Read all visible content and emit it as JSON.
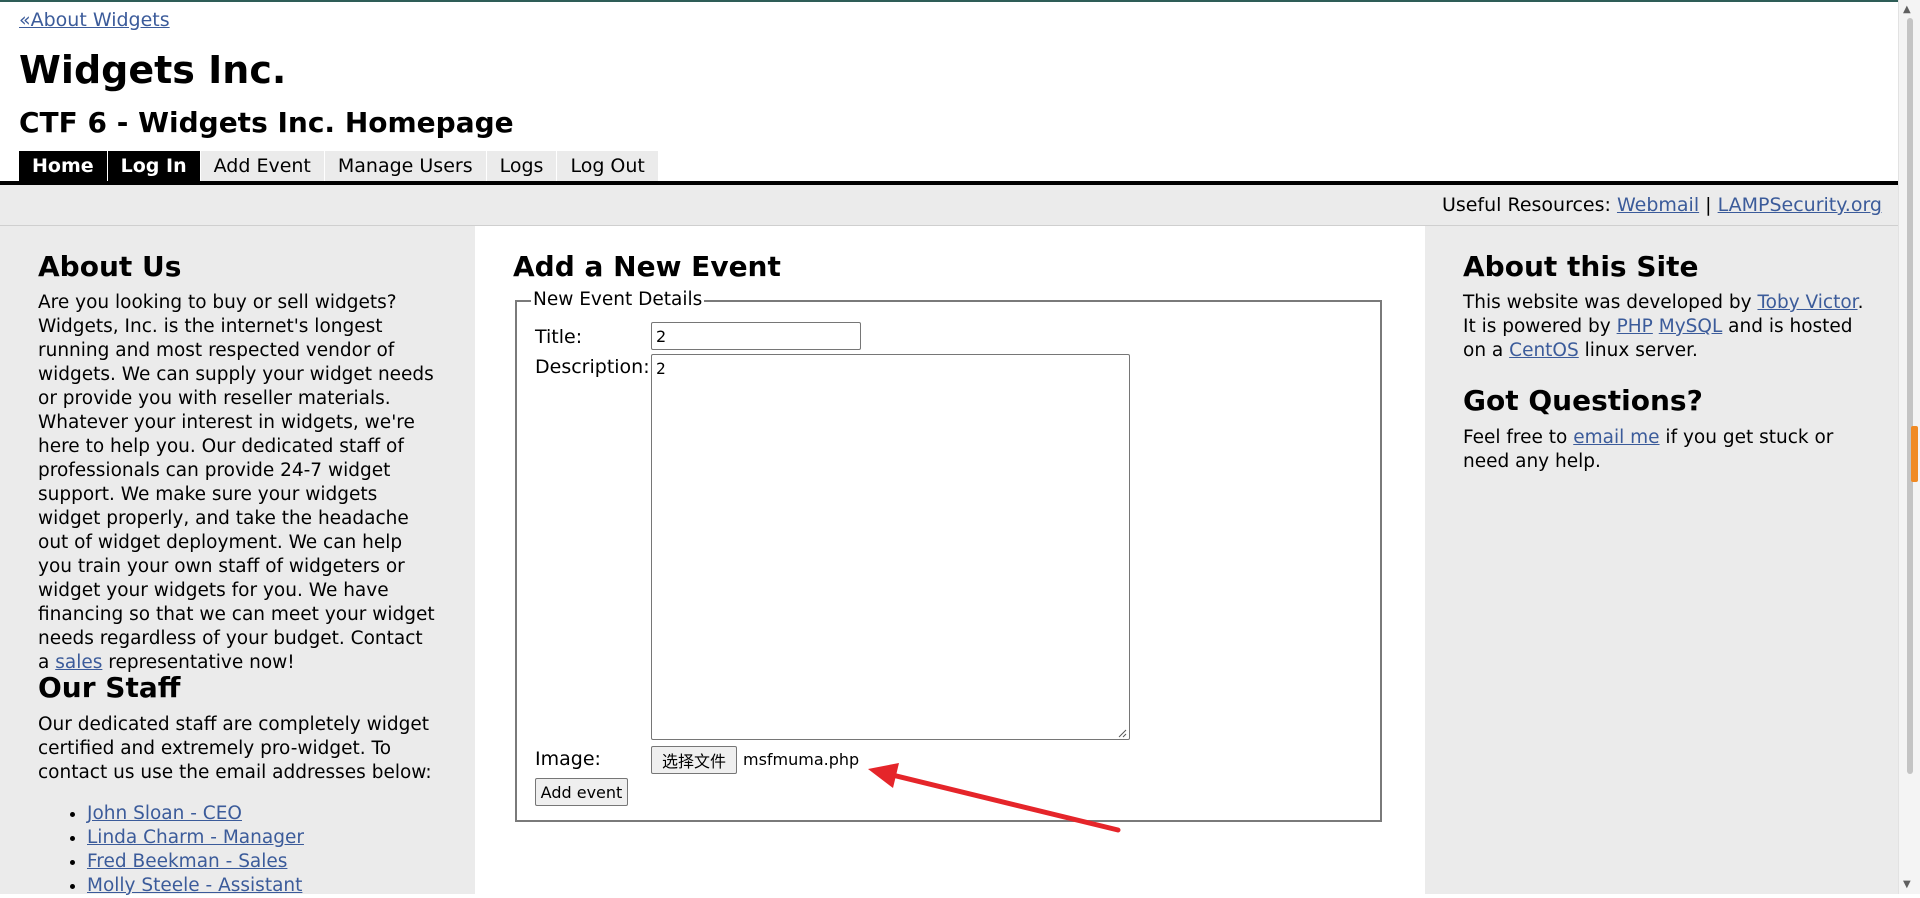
{
  "header": {
    "back_link": "«About Widgets",
    "site_title": "Widgets Inc.",
    "site_subtitle": "CTF 6 - Widgets Inc. Homepage"
  },
  "nav": {
    "items": [
      "Home",
      "Log In",
      "Add Event",
      "Manage Users",
      "Logs",
      "Log Out"
    ],
    "active": [
      "Home",
      "Log In"
    ]
  },
  "resources": {
    "label": "Useful Resources:",
    "links": [
      "Webmail",
      "LAMPSecurity.org"
    ],
    "separator": "|"
  },
  "left": {
    "about_heading": "About Us",
    "about_text": "Are you looking to buy or sell widgets? Widgets, Inc. is the internet's longest running and most respected vendor of widgets. We can supply your widget needs or provide you with reseller materials. Whatever your interest in widgets, we're here to help you. Our dedicated staff of professionals can provide 24-7 widget support. We make sure your widgets widget properly, and take the headache out of widget deployment. We can help you train your own staff of widgeters or widget your widgets for you. We have financing so that we can meet your widget needs regardless of your budget. Contact a",
    "about_link": "sales",
    "about_tail": " representative now!",
    "staff_heading": "Our Staff",
    "staff_text": "Our dedicated staff are completely widget certified and extremely pro-widget. To contact us use the email addresses below:",
    "staff": [
      "John Sloan - CEO",
      "Linda Charm - Manager",
      "Fred Beekman - Sales",
      "Molly Steele - Assistant"
    ]
  },
  "center": {
    "heading": "Add a New Event",
    "legend": "New Event Details",
    "title_label": "Title:",
    "title_value": "2",
    "description_label": "Description:",
    "description_value": "2",
    "image_label": "Image:",
    "file_button": "选择文件",
    "file_name": "msfmuma.php",
    "submit": "Add event"
  },
  "right": {
    "site_heading": "About this Site",
    "site_text_1": "This website was developed by ",
    "site_link_1": "Toby Victor",
    "site_text_2": ". It is powered by ",
    "site_link_2": "PHP",
    "site_text_3": " ",
    "site_link_3": "MySQL",
    "site_text_4": " and is hosted on a ",
    "site_link_4": "CentOS",
    "site_text_5": " linux server.",
    "questions_heading": "Got Questions?",
    "questions_text_1": "Feel free to ",
    "questions_link": "email me",
    "questions_text_2": " if you get stuck or need any help."
  },
  "colors": {
    "link": "#3b5b9a",
    "nav_active_bg": "#000000",
    "sidebar_bg": "#ebebeb",
    "annotation_arrow": "#e5252a",
    "scroll_marker": "#f08a24"
  }
}
